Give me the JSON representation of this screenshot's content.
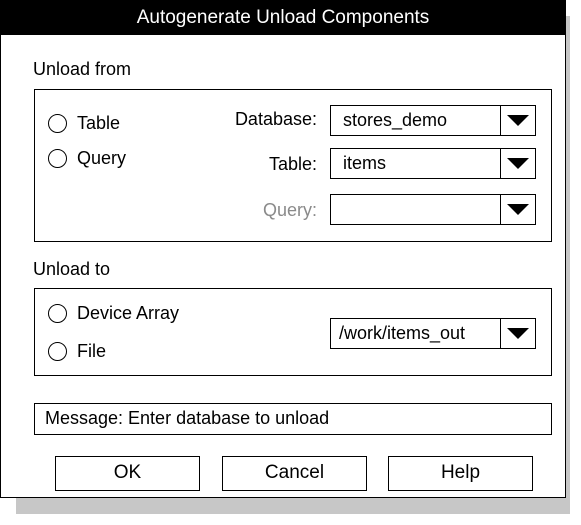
{
  "dialog": {
    "title": "Autogenerate Unload Components"
  },
  "unload_from": {
    "label": "Unload from",
    "radios": {
      "table": "Table",
      "query": "Query"
    },
    "fields": {
      "database": {
        "label": "Database:",
        "value": "stores_demo",
        "icon": "dropdown-arrow-icon"
      },
      "table": {
        "label": "Table:",
        "value": "items",
        "icon": "dropdown-arrow-icon"
      },
      "query": {
        "label": "Query:",
        "value": "",
        "disabled": true,
        "icon": "dropdown-arrow-icon"
      }
    }
  },
  "unload_to": {
    "label": "Unload to",
    "radios": {
      "device_array": "Device Array",
      "file": "File"
    },
    "target": {
      "value": "/work/items_out",
      "icon": "dropdown-arrow-icon"
    }
  },
  "message": {
    "text": "Message: Enter database to unload"
  },
  "buttons": {
    "ok": "OK",
    "cancel": "Cancel",
    "help": "Help"
  },
  "colors": {
    "title_bar": "#000000",
    "disabled_text": "#8a8a8a",
    "shadow": "#c7c7c7"
  }
}
